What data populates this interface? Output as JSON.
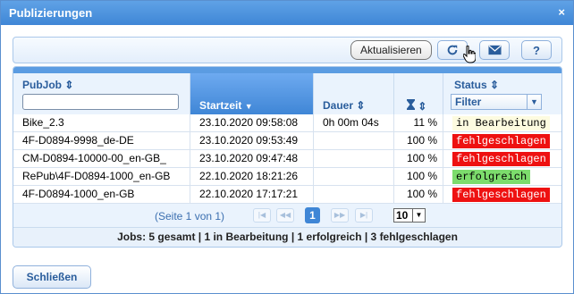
{
  "window": {
    "title": "Publizierungen",
    "close_glyph": "×"
  },
  "toolbar": {
    "tooltip": "Aktualisieren",
    "buttons": [
      {
        "icon": "refresh-icon"
      },
      {
        "icon": "envelope-icon"
      },
      {
        "icon": "help-icon",
        "glyph": "?"
      }
    ]
  },
  "table": {
    "columns": {
      "pubjob": "PubJob",
      "startzeit": "Startzeit",
      "dauer": "Dauer",
      "progress_icon": "hourglass-icon",
      "status": "Status",
      "status_filter": "Filter"
    },
    "sort_glyph": "⇕",
    "sort_active": "▼",
    "rows": [
      {
        "pubjob": "Bike_2.3",
        "startzeit": "23.10.2020 09:58:08",
        "dauer": "0h 00m 04s",
        "percent": "11 %",
        "status": "in Bearbeitung",
        "status_bg": "#fdfbe0",
        "status_fg": "#000000"
      },
      {
        "pubjob": "4F-D0894-9998_de-DE",
        "startzeit": "23.10.2020 09:53:49",
        "dauer": "",
        "percent": "100 %",
        "status": "fehlgeschlagen",
        "status_bg": "#ee1111",
        "status_fg": "#ffffff"
      },
      {
        "pubjob": "CM-D0894-10000-00_en-GB_",
        "startzeit": "23.10.2020 09:47:48",
        "dauer": "",
        "percent": "100 %",
        "status": "fehlgeschlagen",
        "status_bg": "#ee1111",
        "status_fg": "#ffffff"
      },
      {
        "pubjob": "RePub\\4F-D0894-1000_en-GB",
        "startzeit": "22.10.2020 18:21:26",
        "dauer": "",
        "percent": "100 %",
        "status": "erfolgreich",
        "status_bg": "#7cdc6c",
        "status_fg": "#000000"
      },
      {
        "pubjob": "4F-D0894-1000_en-GB",
        "startzeit": "22.10.2020 17:17:21",
        "dauer": "",
        "percent": "100 %",
        "status": "fehlgeschlagen",
        "status_bg": "#ee1111",
        "status_fg": "#ffffff"
      }
    ]
  },
  "pager": {
    "info": "(Seite 1 von 1)",
    "current_page": "1",
    "page_size": "10",
    "first_glyph": "|◀",
    "prev_glyph": "◀◀",
    "next_glyph": "▶▶",
    "last_glyph": "▶|",
    "dropdown_glyph": "▼"
  },
  "summary": "Jobs: 5 gesamt | 1 in Bearbeitung | 1 erfolgreich | 3 fehlgeschlagen",
  "footer": {
    "close_label": "Schließen"
  },
  "colors": {
    "accent": "#3f86d6",
    "header_text": "#2a5d9c",
    "fail": "#ee1111",
    "success": "#7cdc6c",
    "running": "#fdfbe0"
  }
}
